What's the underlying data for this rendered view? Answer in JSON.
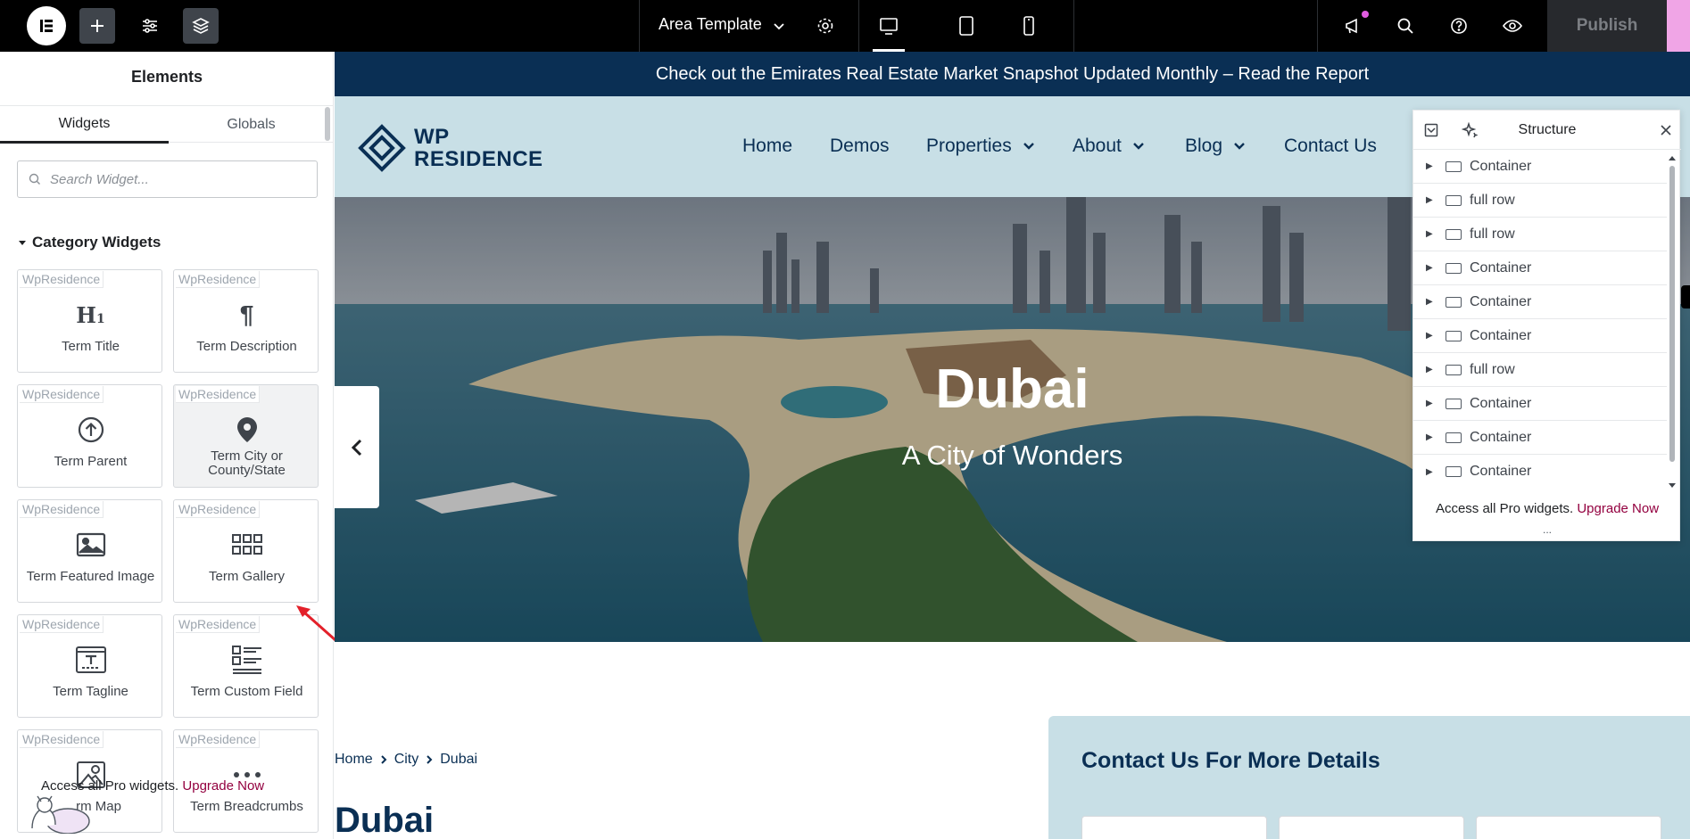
{
  "topbar": {
    "template_title": "Area Template",
    "publish_label": "Publish",
    "icons": [
      "elementor-logo-icon",
      "add-icon",
      "settings-sliders-icon",
      "layers-icon",
      "chevron-down-icon",
      "gear-icon",
      "desktop-icon",
      "tablet-icon",
      "mobile-icon",
      "megaphone-icon",
      "search-icon",
      "help-icon",
      "eye-icon"
    ]
  },
  "panel": {
    "title": "Elements",
    "tabs": [
      "Widgets",
      "Globals"
    ],
    "search_placeholder": "Search Widget...",
    "category_label": "Category Widgets",
    "widgets": [
      {
        "badge": "WpResidence",
        "label": "Term Title",
        "icon": "heading-icon"
      },
      {
        "badge": "WpResidence",
        "label": "Term Description",
        "icon": "paragraph-icon"
      },
      {
        "badge": "WpResidence",
        "label": "Term Parent",
        "icon": "arrow-up-circle-icon"
      },
      {
        "badge": "WpResidence",
        "label": "Term City or County/State",
        "icon": "map-pin-icon"
      },
      {
        "badge": "WpResidence",
        "label": "Term Featured Image",
        "icon": "image-icon"
      },
      {
        "badge": "WpResidence",
        "label": "Term Gallery",
        "icon": "gallery-grid-icon"
      },
      {
        "badge": "WpResidence",
        "label": "Term Tagline",
        "icon": "tagline-icon"
      },
      {
        "badge": "WpResidence",
        "label": "Term Custom Field",
        "icon": "list-icon"
      },
      {
        "badge": "WpResidence",
        "label": "rm Map",
        "icon": "map-icon"
      },
      {
        "badge": "WpResidence",
        "label": "Term Breadcrumbs",
        "icon": "dots-icon"
      }
    ],
    "promo_text": "Access all Pro widgets.",
    "promo_link": "Upgrade Now"
  },
  "site": {
    "announcement": "Check out the Emirates Real Estate Market Snapshot Updated Monthly – Read the Report",
    "brand_line1": "WP",
    "brand_line2": "RESIDENCE",
    "nav": [
      "Home",
      "Demos",
      "Properties",
      "About",
      "Blog",
      "Contact Us"
    ],
    "hero_title": "Dubai",
    "hero_subtitle": "A City of Wonders",
    "breadcrumbs": [
      "Home",
      "City",
      "Dubai"
    ],
    "page_title": "Dubai",
    "contact_title": "Contact Us For More Details"
  },
  "structure": {
    "title": "Structure",
    "rows": [
      "Container",
      "full row",
      "full row",
      "Container",
      "Container",
      "Container",
      "full row",
      "Container",
      "Container",
      "Container"
    ],
    "promo_text": "Access all Pro widgets.",
    "promo_link": "Upgrade Now",
    "more": "..."
  },
  "colors": {
    "navy": "#0a2f54",
    "nav_bg": "#c8dfe6",
    "upgrade": "#93003f",
    "annotation_arrow": "#e3202a"
  }
}
